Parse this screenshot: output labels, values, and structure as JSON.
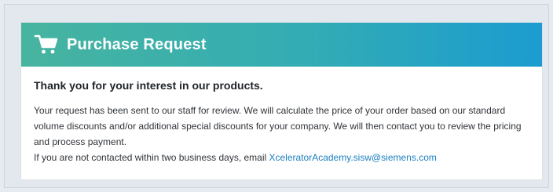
{
  "header": {
    "title": "Purchase Request",
    "icon": "shopping-cart-icon",
    "gradient": [
      "#47b4a0",
      "#33acb4",
      "#1b9cd0"
    ]
  },
  "content": {
    "heading": "Thank you for your interest in our products.",
    "paragraph": "Your request has been sent to our staff for review. We will calculate the price of your order based on our standard volume discounts and/or additional special discounts for your company. We will then contact you to review the pricing and process payment.",
    "contact_prefix": "If you are not contacted within two business days, email ",
    "contact_email": "XceleratorAcademy.sisw@siemens.com"
  },
  "colors": {
    "link": "#1a7fc0",
    "page_bg": "#e6eaf1"
  }
}
